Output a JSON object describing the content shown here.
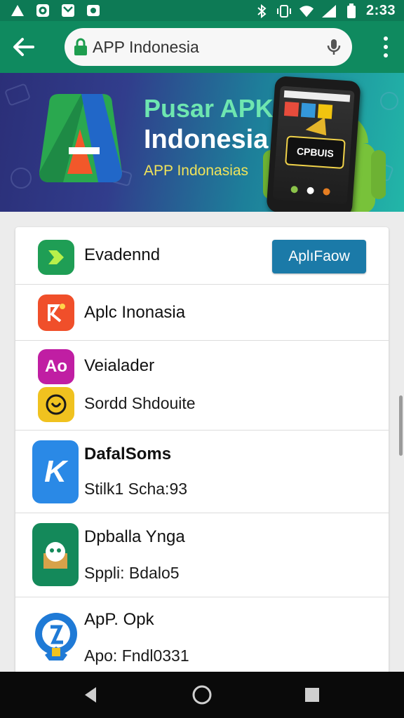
{
  "status_bar": {
    "time": "2:33",
    "left_icons": [
      "warning-icon",
      "app-notification-icon",
      "message-icon",
      "camera-icon"
    ],
    "right_icons": [
      "bluetooth-icon",
      "vibrate-icon",
      "wifi-icon",
      "signal-icon",
      "battery-icon"
    ]
  },
  "browser": {
    "url": "APP Indonesia"
  },
  "banner": {
    "title_line1": "Pusar APK",
    "title_line2": "Indonesia",
    "subtitle": "APP Indonasias",
    "phone_label": "CPBUIS"
  },
  "list": {
    "items": [
      {
        "title": "Evadennd",
        "button_label": "AplıFaow",
        "icon": "app-green-icon",
        "icon_color": "#1f9e55"
      },
      {
        "title": "Aplc Inonasia",
        "icon": "app-orange-icon",
        "icon_color": "#f04f2a"
      },
      {
        "title": "Veialader",
        "icon": "app-magenta-icon",
        "icon_glyph": "Ao",
        "icon_color": "#c01ea3",
        "subtitle": "Sordd Shdouite",
        "sub_icon": "app-yellow-chat-icon",
        "sub_icon_color": "#f0c21f"
      },
      {
        "title": "DafalSoms",
        "subtitle": "Stilk1 Scha:93",
        "icon": "app-blue-icon",
        "icon_glyph": "K",
        "icon_color": "#2a89e6"
      },
      {
        "title": "Dpballa Ynga",
        "subtitle": "Sppli: Bdalo5",
        "icon": "app-robot-icon",
        "icon_color": "#14895a"
      },
      {
        "title": "ApP. Opk",
        "subtitle": "Apo: Fndl0331",
        "icon": "app-blue-circle-icon",
        "icon_color": "#1f7ad6"
      }
    ]
  },
  "nav_bar": {
    "buttons": [
      "back-nav-icon",
      "home-nav-icon",
      "recents-nav-icon"
    ]
  },
  "colors": {
    "app_bar": "#0f8a5f",
    "status_bar": "#0d7a55",
    "install_button": "#1b7aa8"
  }
}
